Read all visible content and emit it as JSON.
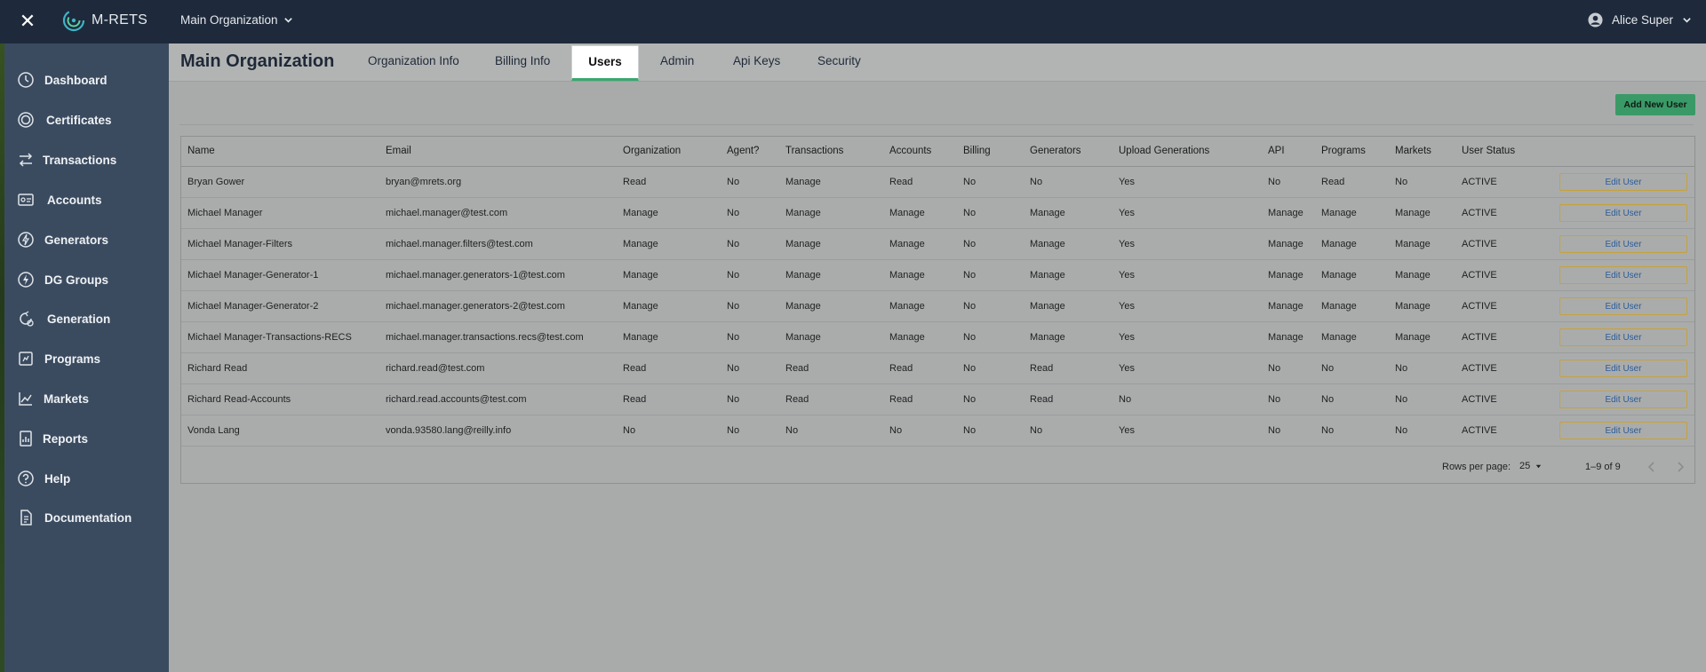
{
  "app": {
    "brand": "M-RETS",
    "org_switcher": "Main Organization",
    "user_name": "Alice Super"
  },
  "sidebar": {
    "items": [
      {
        "label": "Dashboard",
        "icon": "dashboard-icon"
      },
      {
        "label": "Certificates",
        "icon": "certificate-icon"
      },
      {
        "label": "Transactions",
        "icon": "transfer-icon"
      },
      {
        "label": "Accounts",
        "icon": "account-icon"
      },
      {
        "label": "Generators",
        "icon": "bolt-icon"
      },
      {
        "label": "DG Groups",
        "icon": "dg-group-icon"
      },
      {
        "label": "Generation",
        "icon": "generation-icon"
      },
      {
        "label": "Programs",
        "icon": "programs-icon"
      },
      {
        "label": "Markets",
        "icon": "chart-icon"
      },
      {
        "label": "Reports",
        "icon": "reports-icon"
      },
      {
        "label": "Help",
        "icon": "help-icon"
      },
      {
        "label": "Documentation",
        "icon": "document-icon"
      }
    ]
  },
  "header": {
    "title": "Main Organization",
    "tabs": [
      "Organization Info",
      "Billing Info",
      "Users",
      "Admin",
      "Api Keys",
      "Security"
    ],
    "active_tab": "Users"
  },
  "actions": {
    "add_user": "Add New User"
  },
  "table": {
    "columns": [
      "Name",
      "Email",
      "Organization",
      "Agent?",
      "Transactions",
      "Accounts",
      "Billing",
      "Generators",
      "Upload Generations",
      "API",
      "Programs",
      "Markets",
      "User Status"
    ],
    "edit_label": "Edit User",
    "rows": [
      [
        "Bryan Gower",
        "bryan@mrets.org",
        "Read",
        "No",
        "Manage",
        "Read",
        "No",
        "No",
        "Yes",
        "No",
        "Read",
        "No",
        "ACTIVE"
      ],
      [
        "Michael Manager",
        "michael.manager@test.com",
        "Manage",
        "No",
        "Manage",
        "Manage",
        "No",
        "Manage",
        "Yes",
        "Manage",
        "Manage",
        "Manage",
        "ACTIVE"
      ],
      [
        "Michael Manager-Filters",
        "michael.manager.filters@test.com",
        "Manage",
        "No",
        "Manage",
        "Manage",
        "No",
        "Manage",
        "Yes",
        "Manage",
        "Manage",
        "Manage",
        "ACTIVE"
      ],
      [
        "Michael Manager-Generator-1",
        "michael.manager.generators-1@test.com",
        "Manage",
        "No",
        "Manage",
        "Manage",
        "No",
        "Manage",
        "Yes",
        "Manage",
        "Manage",
        "Manage",
        "ACTIVE"
      ],
      [
        "Michael Manager-Generator-2",
        "michael.manager.generators-2@test.com",
        "Manage",
        "No",
        "Manage",
        "Manage",
        "No",
        "Manage",
        "Yes",
        "Manage",
        "Manage",
        "Manage",
        "ACTIVE"
      ],
      [
        "Michael Manager-Transactions-RECS",
        "michael.manager.transactions.recs@test.com",
        "Manage",
        "No",
        "Manage",
        "Manage",
        "No",
        "Manage",
        "Yes",
        "Manage",
        "Manage",
        "Manage",
        "ACTIVE"
      ],
      [
        "Richard Read",
        "richard.read@test.com",
        "Read",
        "No",
        "Read",
        "Read",
        "No",
        "Read",
        "Yes",
        "No",
        "No",
        "No",
        "ACTIVE"
      ],
      [
        "Richard Read-Accounts",
        "richard.read.accounts@test.com",
        "Read",
        "No",
        "Read",
        "Read",
        "No",
        "Read",
        "No",
        "No",
        "No",
        "No",
        "ACTIVE"
      ],
      [
        "Vonda Lang",
        "vonda.93580.lang@reilly.info",
        "No",
        "No",
        "No",
        "No",
        "No",
        "No",
        "Yes",
        "No",
        "No",
        "No",
        "ACTIVE"
      ]
    ]
  },
  "pagination": {
    "rows_per_page_label": "Rows per page:",
    "rows_per_page": "25",
    "range": "1–9 of 9"
  },
  "colors": {
    "topbar": "#1e2a3b",
    "sidebar": "#3b4b5f",
    "accent": "#3aa76d",
    "edit_border": "#c6a23a"
  }
}
